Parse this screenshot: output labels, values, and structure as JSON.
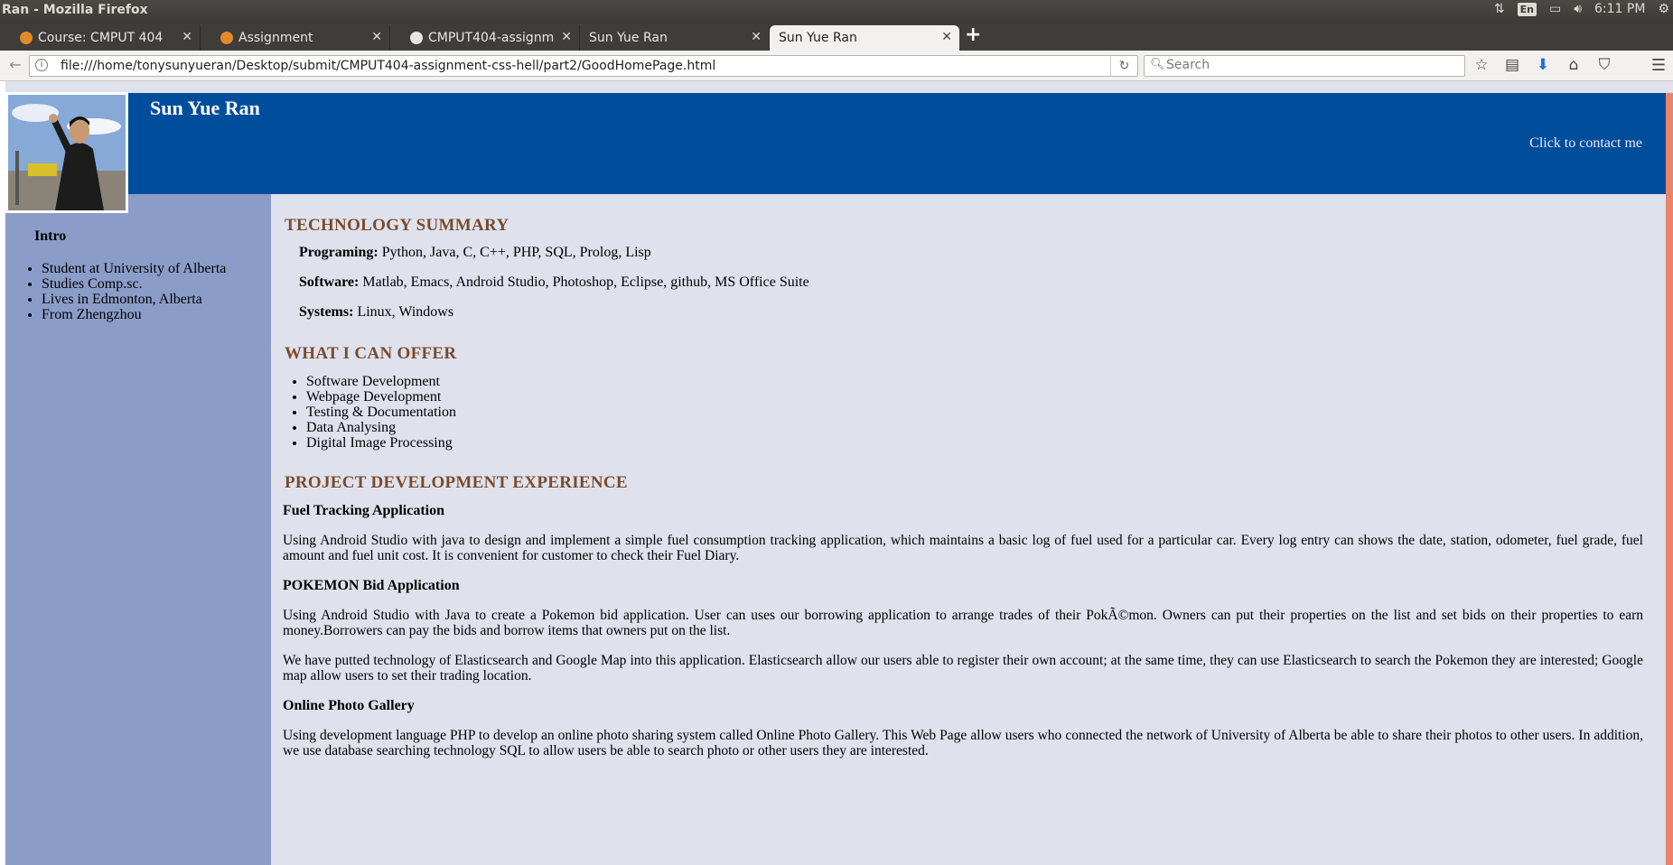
{
  "os": {
    "window_title": "Ran - Mozilla Firefox",
    "lang_indicator": "En",
    "clock": "6:11 PM"
  },
  "tabs": [
    {
      "label": "Course: CMPUT 404 ...",
      "favicon": "eclass-icon",
      "active": false
    },
    {
      "label": "Assignment",
      "favicon": "eclass-icon",
      "active": false
    },
    {
      "label": "CMPUT404-assignm...",
      "favicon": "github-icon",
      "active": false
    },
    {
      "label": "Sun Yue Ran",
      "favicon": "",
      "active": false
    },
    {
      "label": "Sun Yue Ran",
      "favicon": "",
      "active": true
    }
  ],
  "navbar": {
    "url": "file:///home/tonysunyueran/Desktop/submit/CMPUT404-assignment-css-hell/part2/GoodHomePage.html",
    "search_placeholder": "Search"
  },
  "page": {
    "header": {
      "name": "Sun Yue Ran",
      "contact_link": "Click to contact me"
    },
    "sidebar": {
      "heading": "Intro",
      "items": [
        "Student at University of Alberta",
        "Studies Comp.sc.",
        "Lives in Edmonton, Alberta",
        "From Zhengzhou"
      ]
    },
    "tech_summary": {
      "heading": "TECHNOLOGY SUMMARY",
      "rows": [
        {
          "label": "Programing:",
          "value": " Python, Java, C, C++, PHP, SQL, Prolog, Lisp"
        },
        {
          "label": "Software:",
          "value": " Matlab, Emacs, Android Studio, Photoshop, Eclipse, github, MS Office Suite"
        },
        {
          "label": "Systems:",
          "value": " Linux, Windows"
        }
      ]
    },
    "offer": {
      "heading": "WHAT I CAN OFFER",
      "items": [
        "Software Development",
        "Webpage Development",
        "Testing & Documentation",
        "Data Analysing",
        "Digital Image Processing"
      ]
    },
    "projects": {
      "heading": "PROJECT DEVELOPMENT EXPERIENCE",
      "list": [
        {
          "title": "Fuel Tracking Application",
          "paragraphs": [
            "Using Android Studio with java to design and implement a simple fuel consumption tracking application, which maintains a basic log of fuel used for a particular car. Every log entry can shows the date, station, odometer, fuel grade, fuel amount and fuel unit cost. It is convenient for customer to check their Fuel Diary."
          ]
        },
        {
          "title": "POKEMON Bid Application",
          "paragraphs": [
            "Using Android Studio with Java to create a Pokemon bid application. User can uses our borrowing application to arrange trades of their PokÃ©mon. Owners can put their properties on the list and set bids on their properties to earn money.Borrowers can pay the bids and borrow items that owners put on the list.",
            "We have putted technology of Elasticsearch and Google Map into this application. Elasticsearch allow our users able to register their own account; at the same time, they can use Elasticsearch to search the Pokemon they are interested; Google map allow users to set their trading location."
          ]
        },
        {
          "title": "Online Photo Gallery",
          "paragraphs": [
            "Using development language PHP to develop an online photo sharing system called Online Photo Gallery. This Web Page allow users who connected the network of University of Alberta be able to share their photos to other users. In addition, we use database searching technology SQL to allow users be able to search photo or other users they are interested."
          ]
        }
      ]
    }
  },
  "colors": {
    "header_bg": "#004d9b",
    "sidebar_bg": "#8b9cc8",
    "content_bg": "#dfe2ec",
    "heading_color": "#7a4b2d",
    "accent_bar": "#e8846a"
  }
}
